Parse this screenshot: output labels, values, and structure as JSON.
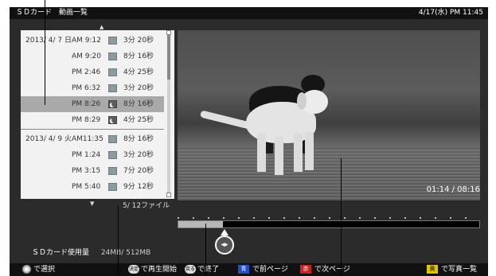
{
  "header": {
    "title": "ＳＤカード　動画一覧",
    "clock": "4/17(水) PM 11:45"
  },
  "list": {
    "rows": [
      {
        "date": "2013/ 4/ 7 日",
        "time": "AM 9:12",
        "icon": "video-thumb-icon",
        "duration": "3分 20秒",
        "selected": false
      },
      {
        "date": "",
        "time": "AM 9:20",
        "icon": "video-thumb-icon",
        "duration": "8分 16秒",
        "selected": false
      },
      {
        "date": "",
        "time": "PM 2:46",
        "icon": "video-thumb-icon",
        "duration": "4分 25秒",
        "selected": false
      },
      {
        "date": "",
        "time": "PM 6:32",
        "icon": "video-thumb-icon",
        "duration": "3分 20秒",
        "selected": false
      },
      {
        "date": "",
        "time": "PM 8:26",
        "icon": "moon-icon",
        "duration": "8分 16秒",
        "selected": true
      },
      {
        "date": "",
        "time": "PM 8:29",
        "icon": "moon-icon",
        "duration": "4分 25秒",
        "selected": false
      },
      {
        "date": "2013/ 4/ 9 火",
        "time": "AM11:35",
        "icon": "video-thumb-icon",
        "duration": "8分 16秒",
        "selected": false
      },
      {
        "date": "",
        "time": "PM 1:24",
        "icon": "video-thumb-icon",
        "duration": "3分 20秒",
        "selected": false
      },
      {
        "date": "",
        "time": "PM 3:15",
        "icon": "video-thumb-icon",
        "duration": "7分 20秒",
        "selected": false
      },
      {
        "date": "",
        "time": "PM 5:40",
        "icon": "video-thumb-icon",
        "duration": "9分 12秒",
        "selected": false
      }
    ],
    "file_count": "5/ 12ファイル"
  },
  "player": {
    "time_readout": "01:14 /  08:16",
    "progress_fraction": 0.149
  },
  "storage": {
    "label": "ＳＤカード使用量",
    "value": "24MB/ 512MB"
  },
  "footer": {
    "select": "で選択",
    "ok_chip": "決定",
    "play": "で再生開始",
    "back_chip": "戻る",
    "end": "で終了",
    "blue_chip": "青",
    "prev_page": "で前ページ",
    "red_chip": "赤",
    "next_page": "で次ページ",
    "yellow_chip": "黄",
    "photo_list": "で写真一覧"
  },
  "colors": {
    "blue": "#1e50c8",
    "red": "#cc2222",
    "yellow": "#e0c400",
    "selected_row": "#a9a9a9",
    "list_bg": "#f2f2f2"
  }
}
